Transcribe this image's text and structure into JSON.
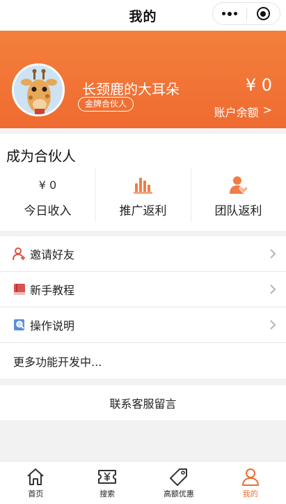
{
  "titlebar": {
    "title": "我的"
  },
  "profile": {
    "nickname": "长颈鹿的大耳朵",
    "badge": "金牌合伙人",
    "balance": "¥ 0",
    "balance_label": "账户余额",
    "balance_arrow": ">"
  },
  "partner": {
    "title": "成为合伙人",
    "stats": [
      {
        "value": "¥ 0",
        "label": "今日收入"
      },
      {
        "icon": "bar-chart-icon",
        "label": "推广返利"
      },
      {
        "icon": "team-heart-icon",
        "label": "团队返利"
      }
    ]
  },
  "menu": [
    {
      "icon": "invite-user-icon",
      "label": "邀请好友"
    },
    {
      "icon": "book-icon",
      "label": "新手教程"
    },
    {
      "icon": "search-doc-icon",
      "label": "操作说明"
    },
    {
      "label": "更多功能开发中..."
    }
  ],
  "contact": "联系客服留言",
  "tabs": [
    {
      "icon": "home-icon",
      "label": "首页"
    },
    {
      "icon": "ticket-yen-icon",
      "label": "搜索"
    },
    {
      "icon": "tag-icon",
      "label": "高额优惠"
    },
    {
      "icon": "user-icon",
      "label": "我的",
      "active": true
    }
  ],
  "colors": {
    "accent": "#ee6a2f",
    "icon_red": "#e0533f",
    "icon_blue": "#5b8ed8"
  }
}
